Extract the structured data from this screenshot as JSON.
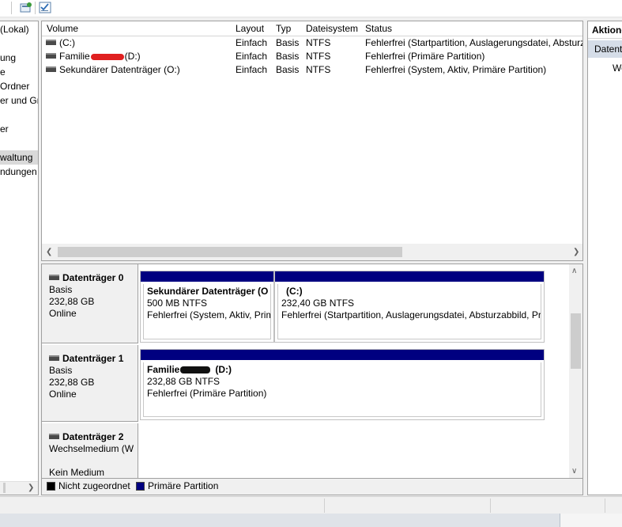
{
  "toolbar": {
    "icons": [
      "properties-icon",
      "console-check-icon"
    ]
  },
  "left_pane": {
    "items": [
      {
        "label": "(Lokal)",
        "selected": false
      },
      {
        "label": "ung",
        "selected": false
      },
      {
        "label": "e",
        "selected": false
      },
      {
        "label": "Ordner",
        "selected": false
      },
      {
        "label": "er und Gru",
        "selected": false
      },
      {
        "label": "er",
        "selected": false
      },
      {
        "label": "waltung",
        "selected": true
      },
      {
        "label": "ndungen",
        "selected": false
      }
    ]
  },
  "volume_table": {
    "columns": [
      "Volume",
      "Layout",
      "Typ",
      "Dateisystem",
      "Status"
    ],
    "rows": [
      {
        "volume": "(C:)",
        "layout": "Einfach",
        "typ": "Basis",
        "fs": "NTFS",
        "status": "Fehlerfrei (Startpartition, Auslagerungsdatei, Absturzabbild, Primäre Partition)"
      },
      {
        "volume": "Familie",
        "volume_suffix": "(D:)",
        "layout": "Einfach",
        "typ": "Basis",
        "fs": "NTFS",
        "status": "Fehlerfrei (Primäre Partition)"
      },
      {
        "volume": "Sekundärer Datenträger (O:)",
        "layout": "Einfach",
        "typ": "Basis",
        "fs": "NTFS",
        "status": "Fehlerfrei (System, Aktiv, Primäre Partition)"
      }
    ]
  },
  "disks": [
    {
      "title": "Datenträger 0",
      "line1": "Basis",
      "line2": "232,88 GB",
      "line3": "Online",
      "partitions": [
        {
          "name": "Sekundärer Datenträger  (O",
          "size": "500 MB NTFS",
          "status": "Fehlerfrei (System, Aktiv, Prim"
        },
        {
          "name": "(C:)",
          "size": "232,40 GB NTFS",
          "status": "Fehlerfrei (Startpartition, Auslagerungsdatei, Absturzabbild, Pr"
        }
      ]
    },
    {
      "title": "Datenträger 1",
      "line1": "Basis",
      "line2": "232,88 GB",
      "line3": "Online",
      "partitions": [
        {
          "name": "Familie",
          "name_suffix": "(D:)",
          "size": "232,88 GB NTFS",
          "status": "Fehlerfrei (Primäre Partition)"
        }
      ]
    },
    {
      "title": "Datenträger 2",
      "line1": "Wechselmedium (W",
      "line2": "",
      "line3": "Kein Medium",
      "partitions": []
    }
  ],
  "legend": [
    {
      "label": "Nicht zugeordnet",
      "color": "#000000"
    },
    {
      "label": "Primäre Partition",
      "color": "#000080"
    }
  ],
  "actions_pane": {
    "header": "Aktionen",
    "selected": "Datenträgerverwaltung",
    "item": "Weitere Aktionen"
  },
  "colors": {
    "primary_partition": "#000080",
    "selected_bg": "#d9d9d9",
    "redaction_red": "#e02020"
  }
}
